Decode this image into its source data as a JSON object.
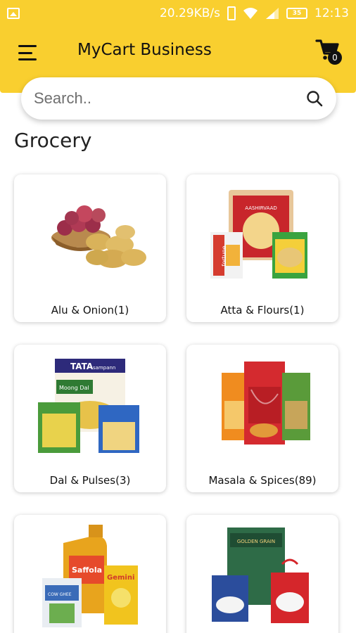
{
  "status_bar": {
    "speed": "20.29KB/s",
    "battery": "35",
    "time": "12:13"
  },
  "app_bar": {
    "title": "MyCart Business",
    "cart_count": "0"
  },
  "search": {
    "placeholder": "Search.."
  },
  "section": {
    "title": "Grocery"
  },
  "categories": [
    {
      "label": "Alu & Onion(1)"
    },
    {
      "label": "Atta & Flours(1)"
    },
    {
      "label": "Dal & Pulses(3)"
    },
    {
      "label": "Masala & Spices(89)"
    },
    {
      "label": ""
    },
    {
      "label": ""
    }
  ],
  "product_text": {
    "atta_brand": "AASHIRVAAD",
    "fortune": "fortune",
    "tata": "TATA",
    "tata_sub": "sampann",
    "moong": "Moong Dal",
    "saffola": "Saffola",
    "gemini": "Gemini",
    "golden_grain": "GOLDEN GRAIN",
    "amul_cow": "COW GHEE"
  },
  "colors": {
    "brand_yellow": "#f9cf2f",
    "text_dark": "#111111"
  }
}
